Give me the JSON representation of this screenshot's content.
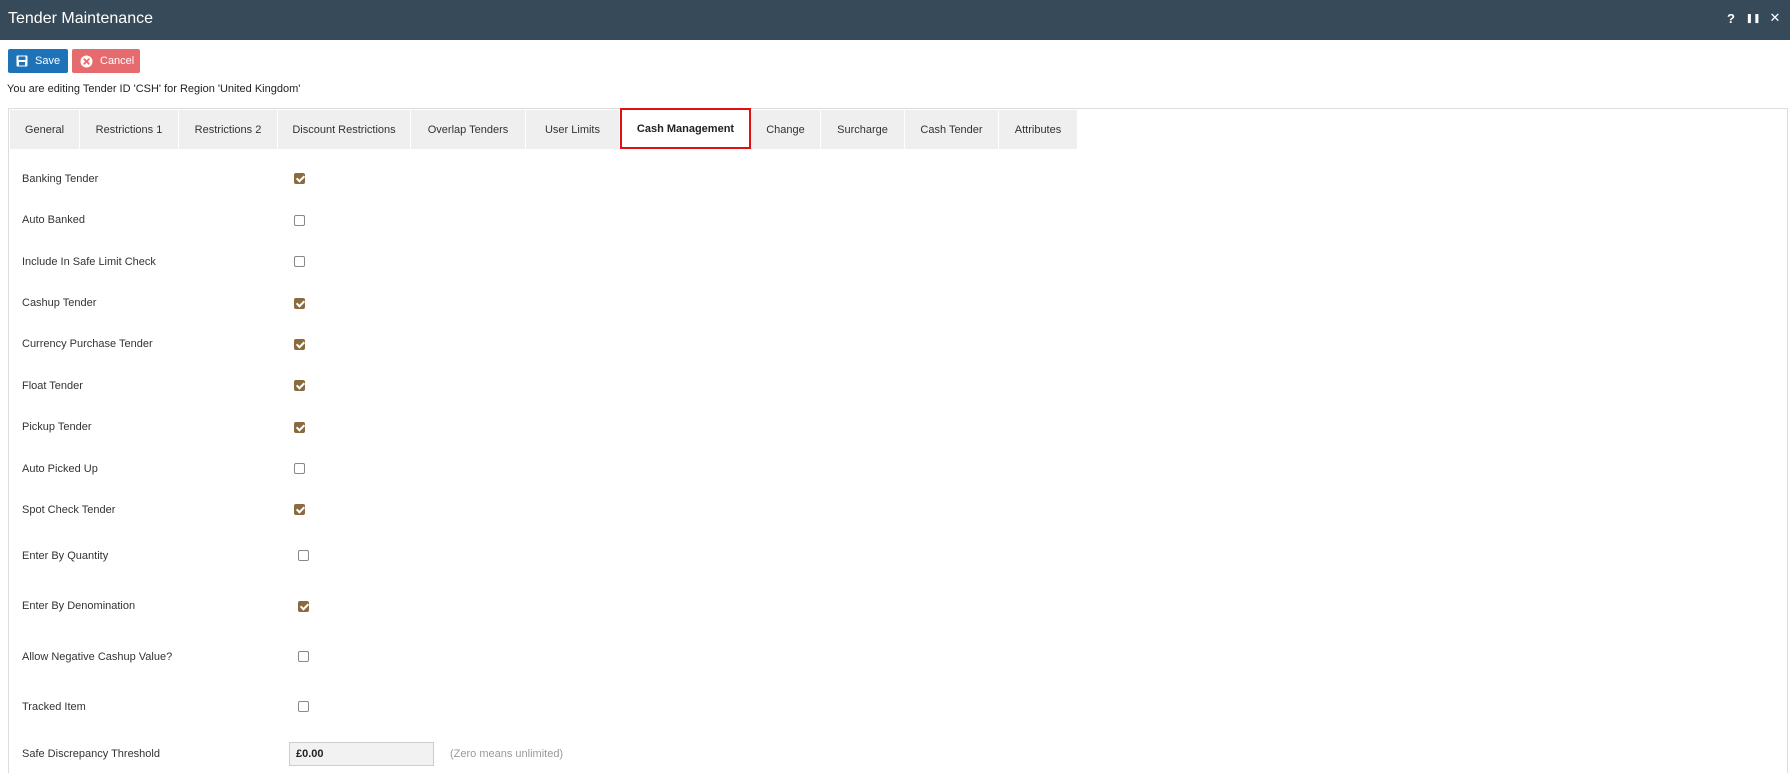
{
  "window": {
    "title": "Tender Maintenance",
    "controls": [
      "?",
      "❚❚",
      "✕"
    ]
  },
  "toolbar": {
    "save_label": "Save",
    "cancel_label": "Cancel"
  },
  "editing_message": "You are editing Tender ID 'CSH' for Region 'United Kingdom'",
  "tabs": [
    {
      "label": "General",
      "active": false
    },
    {
      "label": "Restrictions 1",
      "active": false
    },
    {
      "label": "Restrictions 2",
      "active": false
    },
    {
      "label": "Discount Restrictions",
      "active": false
    },
    {
      "label": "Overlap Tenders",
      "active": false
    },
    {
      "label": "User Limits",
      "active": false
    },
    {
      "label": "Cash Management",
      "active": true
    },
    {
      "label": "Change",
      "active": false
    },
    {
      "label": "Surcharge",
      "active": false
    },
    {
      "label": "Cash Tender",
      "active": false
    },
    {
      "label": "Attributes",
      "active": false
    }
  ],
  "fields": [
    {
      "label": "Banking Tender",
      "checked": true
    },
    {
      "label": "Auto Banked",
      "checked": false
    },
    {
      "label": "Include In Safe Limit Check",
      "checked": false
    },
    {
      "label": "Cashup Tender",
      "checked": true
    },
    {
      "label": "Currency Purchase Tender",
      "checked": true
    },
    {
      "label": "Float Tender",
      "checked": true
    },
    {
      "label": "Pickup Tender",
      "checked": true
    },
    {
      "label": "Auto Picked Up",
      "checked": false
    },
    {
      "label": "Spot Check Tender",
      "checked": true
    },
    {
      "label": "Enter By Quantity",
      "checked": false
    },
    {
      "label": "Enter By Denomination",
      "checked": true
    },
    {
      "label": "Allow Negative Cashup Value?",
      "checked": false
    },
    {
      "label": "Tracked Item",
      "checked": false
    }
  ],
  "safe_discrepancy": {
    "label": "Safe Discrepancy Threshold",
    "value": "£0.00",
    "hint": "(Zero means unlimited)"
  },
  "colors": {
    "titlebar": "#374a5a",
    "save": "#1e73b8",
    "cancel": "#e56b6f",
    "checkbox_checked": "#8a6a3e",
    "active_tab_border": "#e01010"
  }
}
